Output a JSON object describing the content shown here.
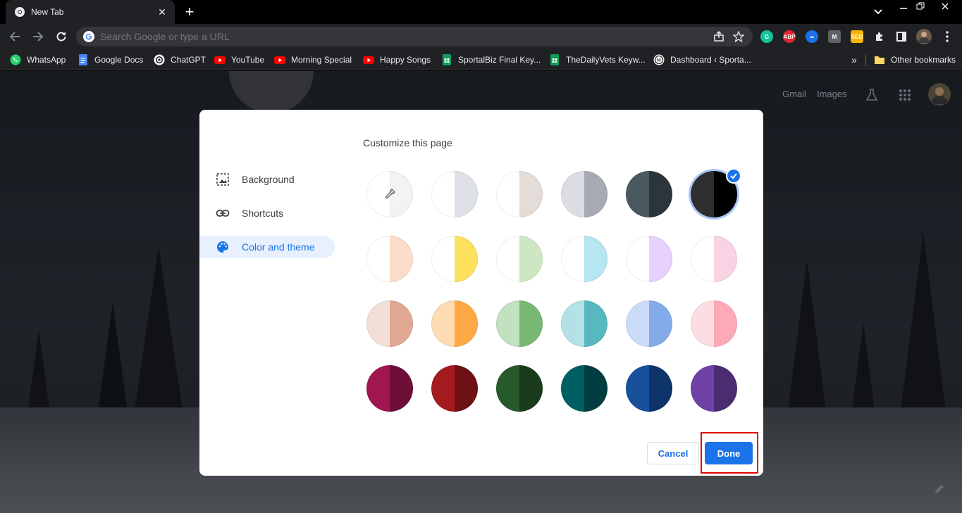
{
  "browser": {
    "tab": {
      "title": "New Tab",
      "close_glyph": "✕"
    },
    "new_tab_glyph": "+",
    "omnibox": {
      "placeholder": "Search Google or type a URL"
    },
    "extensions": [
      {
        "name": "grammarly-icon",
        "label": "G",
        "color": "#15c39a"
      },
      {
        "name": "adblock-plus-icon",
        "label": "ABP",
        "color": "#e0262f"
      },
      {
        "name": "infinity-extension-icon",
        "label": "∞",
        "color": "#1a73e8"
      },
      {
        "name": "m-extension-icon",
        "label": "M",
        "color": "#5f6368"
      },
      {
        "name": "seo-extension-icon",
        "label": "SEO",
        "color": "#f4b400"
      }
    ]
  },
  "bookmarks": {
    "items": [
      {
        "label": "WhatsApp",
        "icon": "whatsapp-icon",
        "color": "#25d366"
      },
      {
        "label": "Google Docs",
        "icon": "google-docs-icon",
        "color": "#4285f4"
      },
      {
        "label": "ChatGPT",
        "icon": "chatgpt-icon",
        "color": "#ffffff"
      },
      {
        "label": "YouTube",
        "icon": "youtube-icon",
        "color": "#ff0000"
      },
      {
        "label": "Morning Special",
        "icon": "youtube-icon",
        "color": "#ff0000"
      },
      {
        "label": "Happy Songs",
        "icon": "youtube-icon",
        "color": "#ff0000"
      },
      {
        "label": "SportalBiz Final Key...",
        "icon": "google-sheets-icon",
        "color": "#0f9d58"
      },
      {
        "label": "TheDailyVets Keyw...",
        "icon": "google-sheets-icon",
        "color": "#0f9d58"
      },
      {
        "label": "Dashboard ‹ Sporta...",
        "icon": "wordpress-icon",
        "color": "#ffffff"
      }
    ],
    "overflow_glyph": "»",
    "other": "Other bookmarks"
  },
  "ntp": {
    "gmail": "Gmail",
    "images": "Images"
  },
  "dialog": {
    "title": "Customize this page",
    "menu": [
      {
        "label": "Background",
        "icon": "background-image-icon"
      },
      {
        "label": "Shortcuts",
        "icon": "link-icon"
      },
      {
        "label": "Color and theme",
        "icon": "palette-icon"
      }
    ],
    "active_menu": "Color and theme",
    "swatches": [
      [
        "custom-picker",
        "#e3e3e3"
      ],
      [
        "#ffffff",
        "#dee1e6"
      ],
      [
        "#ffffff",
        "#e3dcd7"
      ],
      [
        "#dcdde2",
        "#a7aab2"
      ],
      [
        "#4a5860",
        "#2c353b"
      ],
      [
        "#2f2f2f",
        "#000000"
      ],
      [
        "#ffffff",
        "#fcdccb"
      ],
      [
        "#ffffff",
        "#fde15e"
      ],
      [
        "#ffffff",
        "#cde7c3"
      ],
      [
        "#ffffff",
        "#b6e6f0"
      ],
      [
        "#ffffff",
        "#e6d0fc"
      ],
      [
        "#ffffff",
        "#f7d3e3"
      ],
      [
        "#f3ded8",
        "#e1a894"
      ],
      [
        "#fddcb4",
        "#fda945"
      ],
      [
        "#c2e1c0",
        "#77b874"
      ],
      [
        "#b3e1e5",
        "#58b8bf"
      ],
      [
        "#cbdcf6",
        "#83abe9"
      ],
      [
        "#fcdde3",
        "#fda9b7"
      ],
      [
        "#a01650",
        "#6e0f38"
      ],
      [
        "#a31b1e",
        "#6f1114"
      ],
      [
        "#265a2a",
        "#1a3c1c"
      ],
      [
        "#005f63",
        "#003c40"
      ],
      [
        "#17519c",
        "#0d356a"
      ],
      [
        "#6f41a6",
        "#4b2c71"
      ]
    ],
    "selected_swatch": 5,
    "cancel_label": "Cancel",
    "done_label": "Done"
  }
}
